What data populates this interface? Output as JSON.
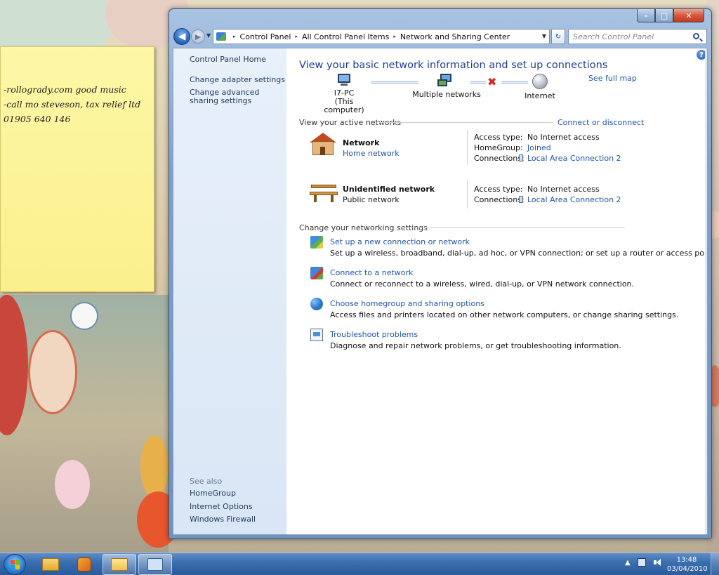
{
  "sticky_note": {
    "lines": [
      "-rollogrady.com good music",
      "-call mo steveson, tax relief ltd",
      "01905 640 146"
    ]
  },
  "window": {
    "caption": {
      "minimize": "–",
      "maximize": "□",
      "close": "✕"
    },
    "address": {
      "back": "◀",
      "forward": "▶",
      "breadcrumbs": [
        "Control Panel",
        "All Control Panel Items",
        "Network and Sharing Center"
      ],
      "separator": "▸",
      "search_placeholder": "Search Control Panel"
    },
    "nav": {
      "home": "Control Panel Home",
      "links": [
        "Change adapter settings",
        "Change advanced sharing settings"
      ],
      "see_also_label": "See also",
      "see_also": [
        "HomeGroup",
        "Internet Options",
        "Windows Firewall"
      ]
    },
    "help": "?",
    "main": {
      "title": "View your basic network information and set up connections",
      "see_full_map": "See full map",
      "map": {
        "computer": {
          "name": "I7-PC",
          "sub": "(This computer)"
        },
        "networks": "Multiple networks",
        "internet": "Internet",
        "broken_marker": "✖"
      },
      "active_networks": {
        "heading": "View your active networks",
        "connect_link": "Connect or disconnect",
        "items": [
          {
            "name": "Network",
            "type": "Home network",
            "access_label": "Access type:",
            "access_value": "No Internet access",
            "homegroup_label": "HomeGroup:",
            "homegroup_value": "Joined",
            "connections_label": "Connections:",
            "connections_value": "Local Area Connection 2"
          },
          {
            "name": "Unidentified network",
            "type": "Public network",
            "access_label": "Access type:",
            "access_value": "No Internet access",
            "connections_label": "Connections:",
            "connections_value": "Local Area Connection 2"
          }
        ]
      },
      "settings": {
        "heading": "Change your networking settings",
        "tasks": [
          {
            "title": "Set up a new connection or network",
            "desc": "Set up a wireless, broadband, dial-up, ad hoc, or VPN connection; or set up a router or access point."
          },
          {
            "title": "Connect to a network",
            "desc": "Connect or reconnect to a wireless, wired, dial-up, or VPN network connection."
          },
          {
            "title": "Choose homegroup and sharing options",
            "desc": "Access files and printers located on other network computers, or change sharing settings."
          },
          {
            "title": "Troubleshoot problems",
            "desc": "Diagnose and repair network problems, or get troubleshooting information."
          }
        ]
      }
    }
  },
  "taskbar": {
    "tray_arrow": "▲",
    "time": "13:48",
    "date": "03/04/2010"
  }
}
